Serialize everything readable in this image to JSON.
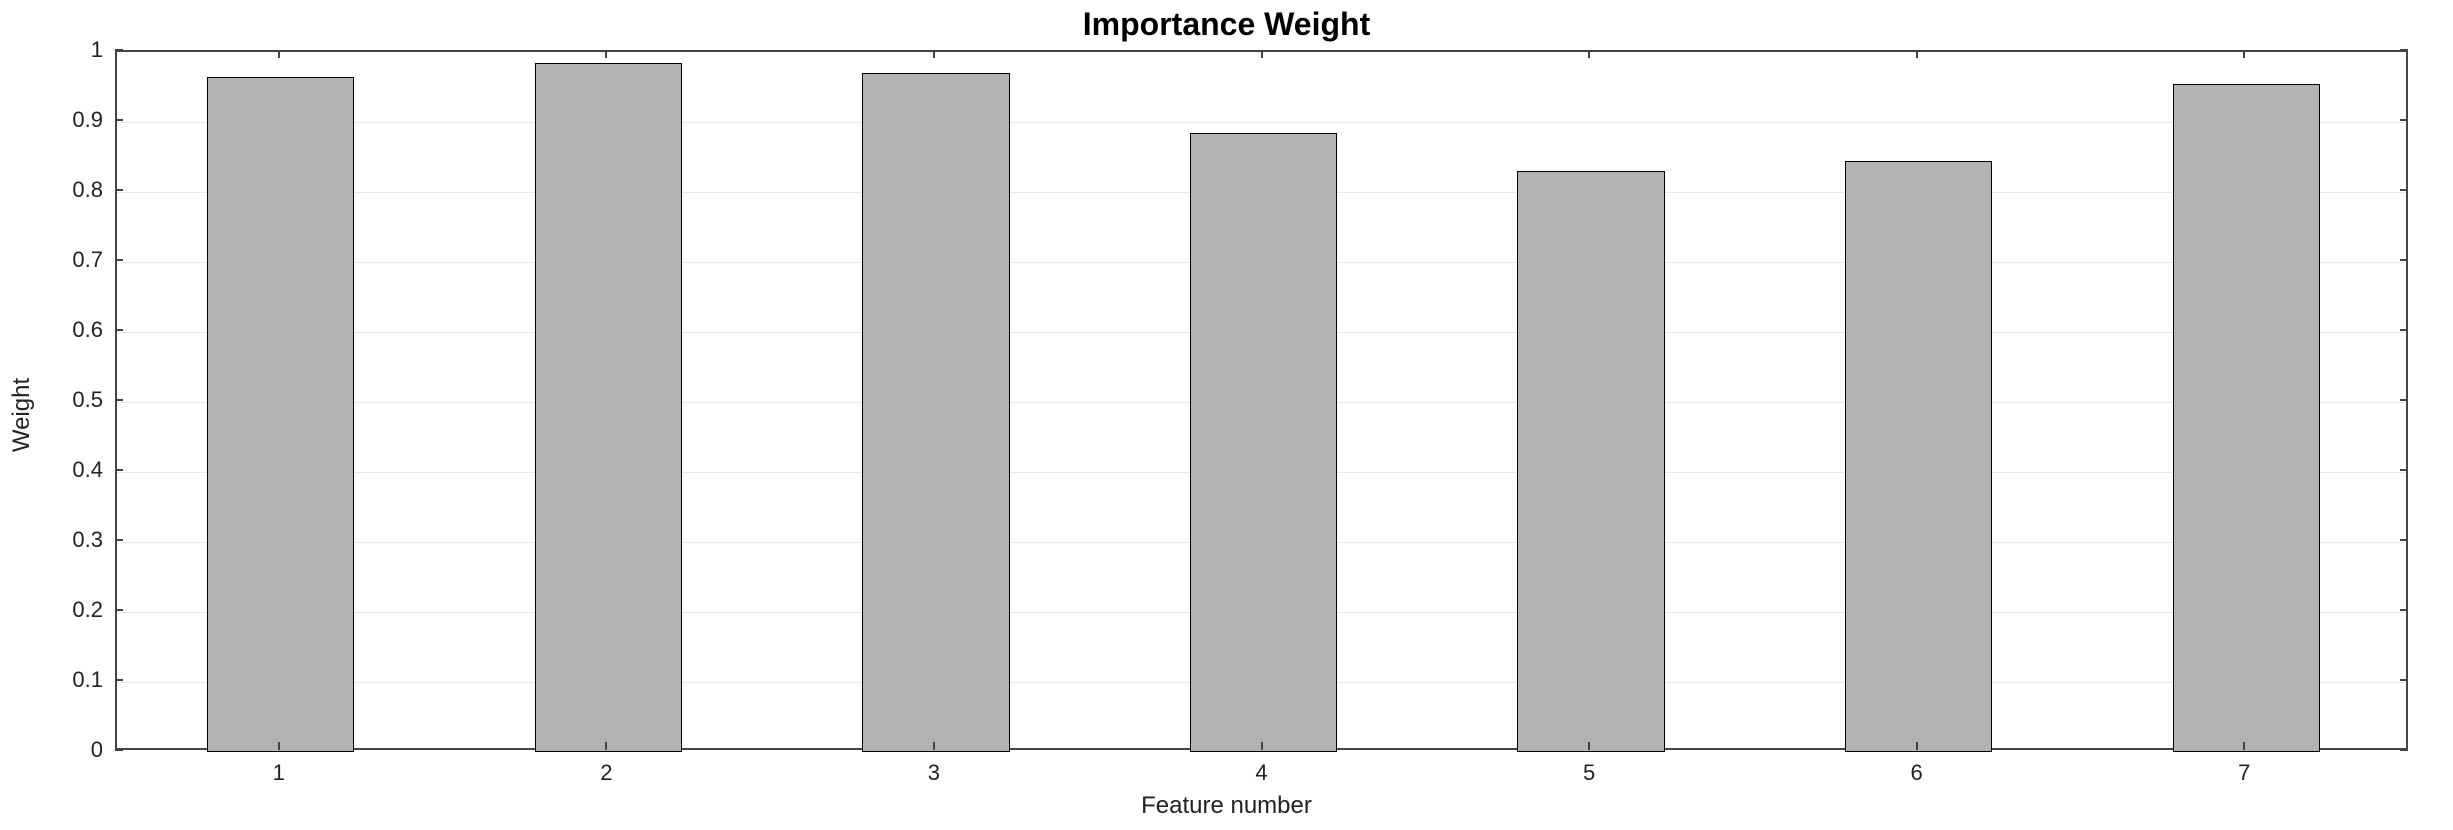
{
  "chart_data": {
    "type": "bar",
    "title": "Importance Weight",
    "xlabel": "Feature number",
    "ylabel": "Weight",
    "categories": [
      "1",
      "2",
      "3",
      "4",
      "5",
      "6",
      "7"
    ],
    "values": [
      0.965,
      0.985,
      0.97,
      0.885,
      0.83,
      0.845,
      0.955
    ],
    "ylim": [
      0,
      1
    ],
    "yticks": [
      0,
      0.1,
      0.2,
      0.3,
      0.4,
      0.5,
      0.6,
      0.7,
      0.8,
      0.9,
      1
    ],
    "ytick_labels": [
      "0",
      "0.1",
      "0.2",
      "0.3",
      "0.4",
      "0.5",
      "0.6",
      "0.7",
      "0.8",
      "0.9",
      "1"
    ],
    "bar_color": "#b3b3b3",
    "bar_edge": "#000000",
    "grid": true
  }
}
